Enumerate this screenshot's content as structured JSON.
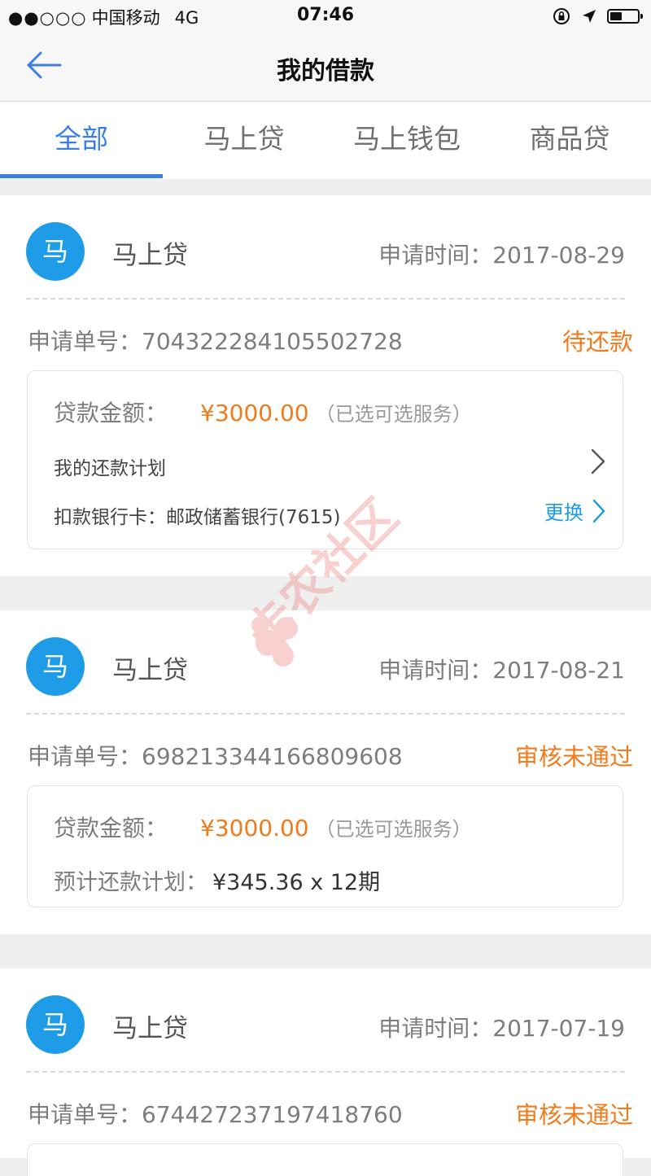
{
  "status_bar": {
    "signal": "●●○○○",
    "carrier": "中国移动",
    "network": "4G",
    "time": "07:46"
  },
  "nav": {
    "title": "我的借款",
    "back_icon": "arrow-left-icon"
  },
  "tabs": [
    {
      "label": "全部",
      "active": true
    },
    {
      "label": "马上贷",
      "active": false
    },
    {
      "label": "马上钱包",
      "active": false
    },
    {
      "label": "商品贷",
      "active": false
    }
  ],
  "colors": {
    "accent": "#3b7fe0",
    "avatar": "#1f9ce8",
    "status_orange": "#f07b1c",
    "link_blue": "#1f9ce8"
  },
  "loans": [
    {
      "avatar_text": "马",
      "product": "马上贷",
      "apply_time_label": "申请时间：",
      "apply_time": "2017-08-29",
      "order_label": "申请单号：",
      "order_no": "704322284105502728",
      "status": "待还款",
      "amount_label": "贷款金额：",
      "amount": "¥3000.00",
      "amount_note": "（已选可选服务）",
      "plan_label": "我的还款计划",
      "bank_label": "扣款银行卡：",
      "bank_value": "邮政储蓄银行(7615)",
      "change_label": "更换"
    },
    {
      "avatar_text": "马",
      "product": "马上贷",
      "apply_time_label": "申请时间：",
      "apply_time": "2017-08-21",
      "order_label": "申请单号：",
      "order_no": "698213344166809608",
      "status": "审核未通过",
      "amount_label": "贷款金额：",
      "amount": "¥3000.00",
      "amount_note": "（已选可选服务）",
      "est_label": "预计还款计划：",
      "est_value": "¥345.36 x 12期"
    },
    {
      "avatar_text": "马",
      "product": "马上贷",
      "apply_time_label": "申请时间：",
      "apply_time": "2017-07-19",
      "order_label": "申请单号：",
      "order_no": "674427237197418760",
      "status": "审核未通过"
    }
  ],
  "watermark_text": "卡农社区"
}
